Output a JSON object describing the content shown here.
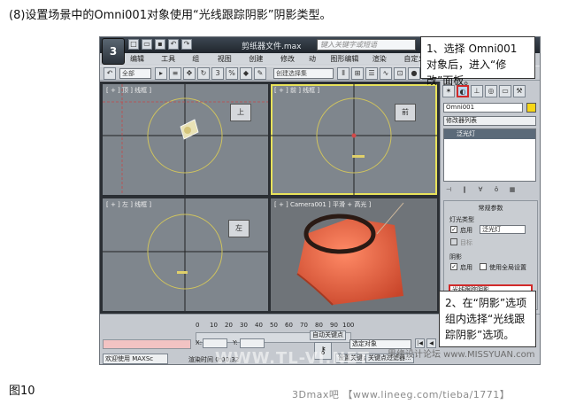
{
  "caption": {
    "step": "(8)设置场景中的Omni001对象使用“光线跟踪阴影”阴影类型。",
    "figure": "图10"
  },
  "titlebar": {
    "logo": "3",
    "title": "剪纸器文件.max",
    "search_placeholder": "键入关键字或短语"
  },
  "menubar": [
    "编辑(E)",
    "工具(T)",
    "组(G)",
    "视图(V)",
    "创建(C)",
    "修改器",
    "动画",
    "图形编辑器",
    "渲染(R)",
    "自定义(U)"
  ],
  "toolbar": {
    "filter": "全部",
    "selection_set": "创建选择集",
    "percent": "%",
    "angle": "3"
  },
  "viewports": [
    {
      "label": "[ + ] 顶 ] 线框 ]",
      "active": false
    },
    {
      "label": "[ + ] 前 ] 线框 ]",
      "active": true
    },
    {
      "label": "[ + ] 左 ] 线框 ]",
      "active": false
    },
    {
      "label": "[ + ] Camera001 ] 平滑 + 高光 ]",
      "active": false
    }
  ],
  "viewcube": {
    "top": "上",
    "front": "前",
    "left": "左"
  },
  "command_panel": {
    "object_name": "Omni001",
    "modifier_list": "修改器列表",
    "stack_item": "泛光灯",
    "rollout_title": "常规参数",
    "light_type_group": "灯光类型",
    "light_enable_label": "启用",
    "light_type_value": "泛光灯",
    "target_label": "目标",
    "shadow_group": "阴影",
    "shadow_enable_label": "启用",
    "global_settings_label": "使用全局设置",
    "shadow_type_value": "光线跟踪阴影"
  },
  "bottombar": {
    "welcome": "欢迎使用 MAXSc",
    "render_time": "渲染时间  0:00:32",
    "ticks": [
      "0",
      "10",
      "20",
      "30",
      "40",
      "50",
      "60",
      "70",
      "80",
      "90",
      "100"
    ],
    "x_label": "X:",
    "y_label": "Y:",
    "auto_key": "自动关键点",
    "set_key": "设置关键点",
    "selection_filter": "选定对象",
    "key_filter": "关键点过滤器..."
  },
  "callouts": {
    "one": "1、选择 Omni001 对象后，进入“修改”面板。",
    "two": "2、在“阴影”选项组内选择“光线跟踪阴影”选项。"
  },
  "watermarks": {
    "center": "WWW.TL-VI.NET",
    "corner": "思缘设计论坛 www.MISSYUAN.com",
    "footer": "3Dmax吧  【www.lineeg.com/tieba/1771】"
  },
  "colors": {
    "highlight": "#d12a2a",
    "active_viewport": "#e8e25a",
    "object_color": "#f7d617",
    "render_orange": "#e2653f"
  }
}
